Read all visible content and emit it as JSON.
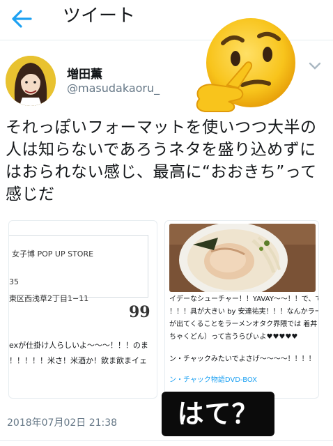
{
  "header": {
    "title": "ツイート",
    "back_icon": "back-arrow-icon"
  },
  "tweet": {
    "display_name": "増田薫",
    "handle": "@masudakaoru_",
    "text": "それっぽいフォーマットを使いつつ大半の人は知らないであろうネタを盛り込めずにはおられない感じ、最高に“おおきち”って感じだ",
    "timestamp": "2018年07月02日 21:38"
  },
  "quote_card": {
    "inner_title": "女子博 POP UP STORE",
    "inner_line2": "35",
    "inner_line3": "東区西浅草2丁目1−11",
    "quote_mark": "99",
    "body_line1": "exが仕掛け人らしいよ〜〜〜！！！のま",
    "body_line2": "！！！！！米さ！米酒か！飲ま飲まイェ"
  },
  "ramen_card": {
    "line1": "イデーなシューチャー！！YAVAY〜〜！！で、でか",
    "line2": "！！！具が大きい by 安達祐実！！！なんかラーメ",
    "line3": "が出てくることをラーメンオタク界隈では 着丼",
    "line4": "ちゃくどん）って言うらぴぃよ♥♥♥♥♥",
    "line5": "ン・チャックみたいでよさげ〜〜〜〜！！！！",
    "link": "ン・チャック物語DVD-BOX"
  },
  "overlay": {
    "sticker_icon": "thinking-face-emoji",
    "badge_text": "はて？"
  },
  "colors": {
    "accent": "#1da1f2",
    "muted": "#657786",
    "badge_bg": "#0b0b0b"
  }
}
